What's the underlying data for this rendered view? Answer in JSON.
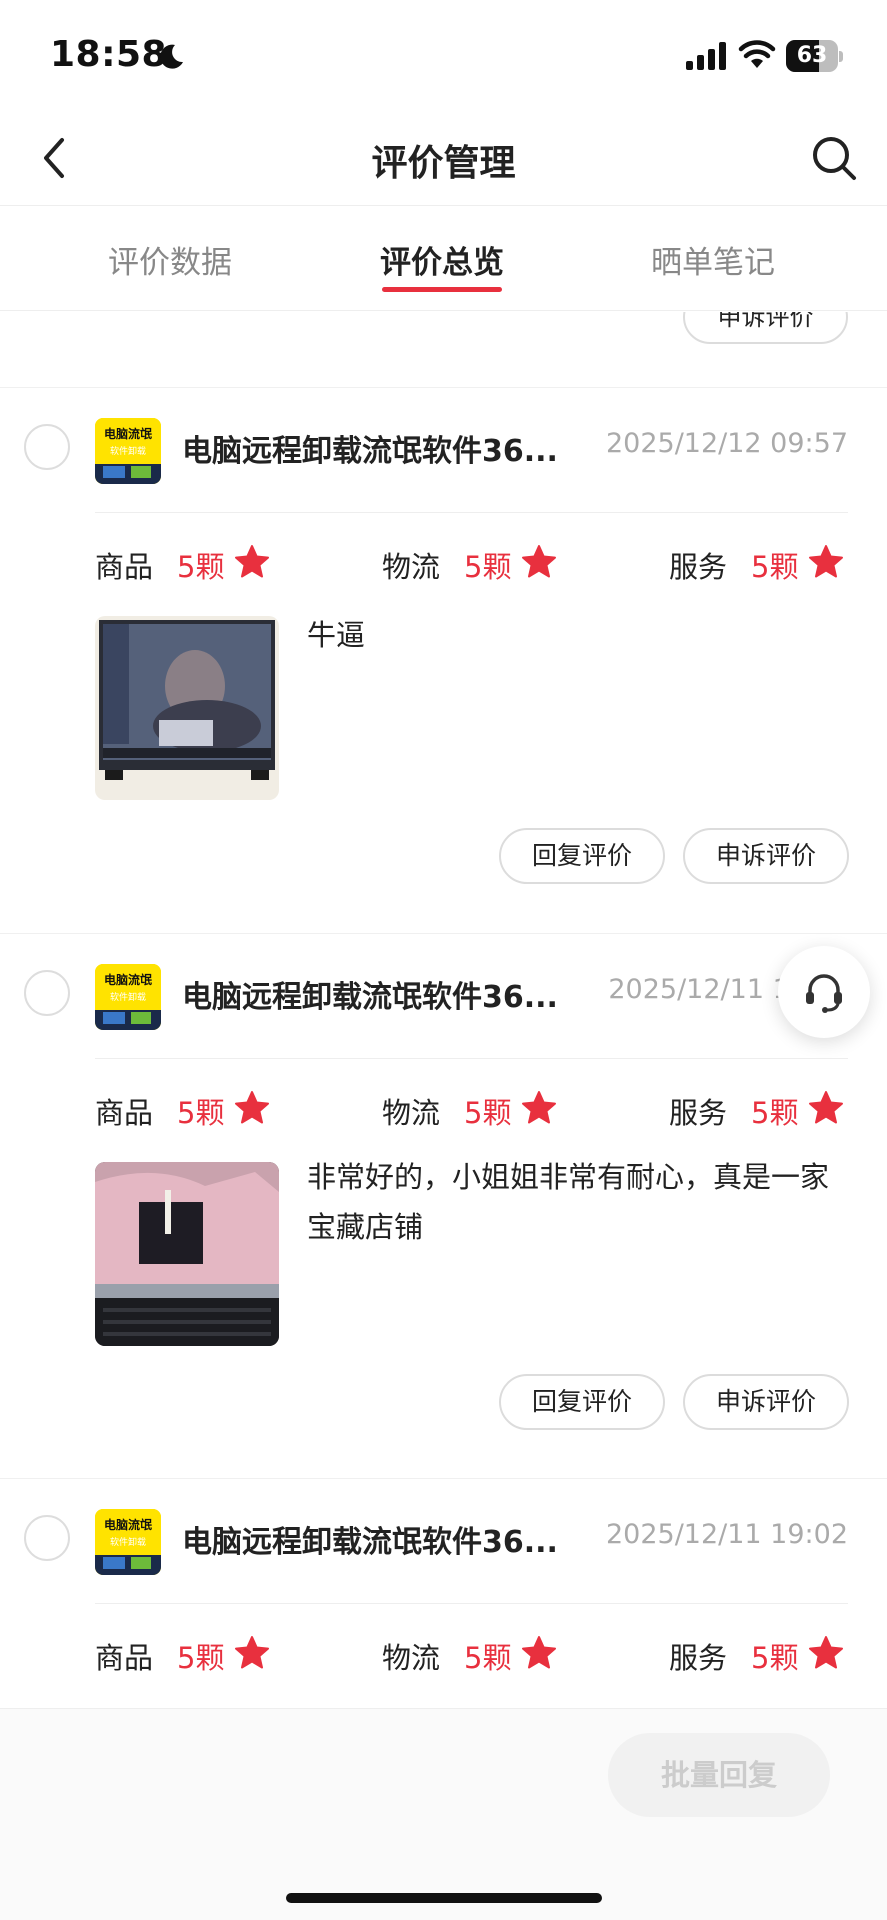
{
  "status_bar": {
    "time": "18:58",
    "battery": "63",
    "battery_level": 0.63
  },
  "header": {
    "title": "评价管理"
  },
  "tabs": [
    {
      "label": "评价数据",
      "active": false
    },
    {
      "label": "评价总览",
      "active": true
    },
    {
      "label": "晒单笔记",
      "active": false
    }
  ],
  "partial_card": {
    "appeal_label": "申诉评价"
  },
  "reviews": [
    {
      "product_name": "电脑远程卸载流氓软件36...",
      "thumb_lines": [
        "电脑流氓",
        "软件卸载"
      ],
      "time": "2025/12/12 09:57",
      "ratings": [
        {
          "label": "商品",
          "value": "5颗"
        },
        {
          "label": "物流",
          "value": "5颗"
        },
        {
          "label": "服务",
          "value": "5颗"
        }
      ],
      "text": "牛逼",
      "reply_label": "回复评价",
      "appeal_label": "申诉评价"
    },
    {
      "product_name": "电脑远程卸载流氓软件36...",
      "thumb_lines": [
        "电脑流氓",
        "软件卸载"
      ],
      "time": "2025/12/11 19:xx",
      "ratings": [
        {
          "label": "商品",
          "value": "5颗"
        },
        {
          "label": "物流",
          "value": "5颗"
        },
        {
          "label": "服务",
          "value": "5颗"
        }
      ],
      "text": "非常好的，小姐姐非常有耐心，真是一家宝藏店铺",
      "reply_label": "回复评价",
      "appeal_label": "申诉评价"
    },
    {
      "product_name": "电脑远程卸载流氓软件36...",
      "thumb_lines": [
        "电脑流氓",
        "软件卸载"
      ],
      "time": "2025/12/11 19:02",
      "ratings": [
        {
          "label": "商品",
          "value": "5颗"
        },
        {
          "label": "物流",
          "value": "5颗"
        },
        {
          "label": "服务",
          "value": "5颗"
        }
      ]
    }
  ],
  "bottom_bar": {
    "batch_reply_label": "批量回复"
  },
  "colors": {
    "accent": "#e8303e",
    "muted": "#aaaaaa",
    "thumb_yellow": "#ffe300"
  },
  "icons": [
    "back-arrow-icon",
    "search-icon",
    "moon-icon",
    "signal-icon",
    "wifi-icon",
    "star-icon",
    "headset-icon"
  ]
}
